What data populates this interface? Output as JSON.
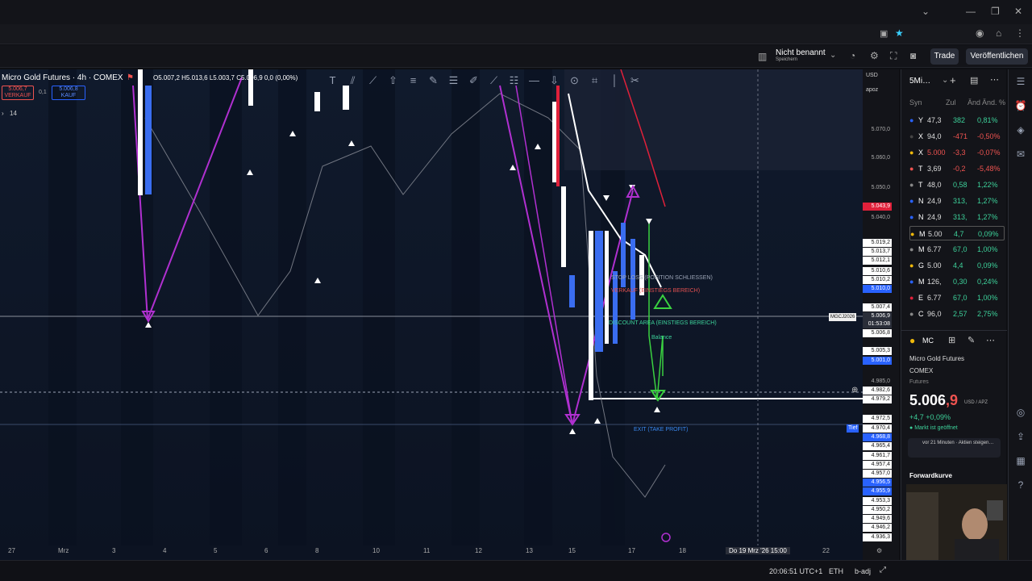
{
  "header": {
    "chart_name": "Nicht benannt",
    "chart_save": "Speichern",
    "trade_label": "Trade",
    "publish_label": "Veröffentlichen"
  },
  "legend": {
    "symbol": "Micro Gold Futures · 4h · COMEX",
    "ohlc": "O5.007,2 H5.013,6 L5.003,7 C5.006,9 0,0 (0,00%)",
    "sell_price": "5.006,7",
    "sell_label": "VERKAUF",
    "spread": "0,1",
    "buy_price": "5.006,8",
    "buy_label": "KAUF",
    "indicator_value": "14"
  },
  "price_axis": {
    "currency": "USD",
    "unit": "apoz",
    "labels": [
      "5.070,0",
      "5.060,0",
      "5.050,0",
      "5.043,9",
      "5.040,0",
      "5.019,2",
      "5.013,7",
      "5.012,1",
      "5.010,6",
      "5.010,2",
      "5.010,0",
      "5.007,4",
      "5.006,9",
      "01:53:08",
      "5.006,8",
      "5.005,3",
      "5.001,0",
      "4.985,0",
      "4.982,6",
      "4.979,2",
      "4.972,5",
      "4.970,4",
      "4.968,8",
      "4.965,4",
      "4.961,7",
      "4.957,4",
      "4.957,0",
      "4.956,5",
      "4.955,9",
      "4.953,3",
      "4.950,2",
      "4.949,6",
      "4.946,2",
      "4.936,3"
    ],
    "symbol_tag": "MGCJ2026",
    "tief_tag": "Tief"
  },
  "annotations": {
    "stop_loss": "STOP LOSS (POSITION SCHLIESSEN)",
    "verkauf_zone": "VERKAUF (EINSTIEGS BEREICH)",
    "discount_zone": "DISCOUNT AREA (EINSTIEGS BEREICH)",
    "balance": "Balance",
    "exit": "EXIT (TAKE PROFIT)"
  },
  "time_axis": {
    "labels": [
      "27",
      "Mrz",
      "3",
      "4",
      "5",
      "6",
      "8",
      "10",
      "11",
      "12",
      "13",
      "15",
      "17",
      "18",
      "22"
    ],
    "crosshair": "Do 19 Mrz '26  15:00"
  },
  "status": {
    "clock": "20:06:51 UTC+1",
    "eth": "ETH",
    "badj": "b-adj"
  },
  "watchlist": {
    "timeframe": "5Mi…",
    "columns": [
      "Syn",
      "Zul",
      "Änd",
      "Änd. %"
    ],
    "rows": [
      {
        "sym": "Y",
        "last": "47,3",
        "chg": "382",
        "pct": "0,81%",
        "dir": "pos"
      },
      {
        "sym": "X",
        "last": "94,0",
        "chg": "-471",
        "pct": "-0,50%",
        "dir": "neg"
      },
      {
        "sym": "X",
        "last": "5.000",
        "chg": "-3,3",
        "pct": "-0,07%",
        "dir": "neg"
      },
      {
        "sym": "T",
        "last": "3,69",
        "chg": "-0,2",
        "pct": "-5,48%",
        "dir": "neg"
      },
      {
        "sym": "T",
        "last": "48,0",
        "chg": "0,58",
        "pct": "1,22%",
        "dir": "pos"
      },
      {
        "sym": "N",
        "last": "24,9",
        "chg": "313,",
        "pct": "1,27%",
        "dir": "pos"
      },
      {
        "sym": "N",
        "last": "24,9",
        "chg": "313,",
        "pct": "1,27%",
        "dir": "pos"
      },
      {
        "sym": "M",
        "last": "5.00",
        "chg": "4,7",
        "pct": "0,09%",
        "dir": "pos"
      },
      {
        "sym": "M",
        "last": "6.77",
        "chg": "67,0",
        "pct": "1,00%",
        "dir": "pos"
      },
      {
        "sym": "G",
        "last": "5.00",
        "chg": "4,4",
        "pct": "0,09%",
        "dir": "pos"
      },
      {
        "sym": "M",
        "last": "126,",
        "chg": "0,30",
        "pct": "0,24%",
        "dir": "pos"
      },
      {
        "sym": "E",
        "last": "6.77",
        "chg": "67,0",
        "pct": "1,00%",
        "dir": "pos"
      },
      {
        "sym": "C",
        "last": "96,0",
        "chg": "2,57",
        "pct": "2,75%",
        "dir": "pos"
      }
    ]
  },
  "details": {
    "short": "MC",
    "name": "Micro Gold Futures",
    "exchange": "COMEX",
    "type": "Futures",
    "price_main": "5.006",
    "price_frac": ",9",
    "unit": "USD / APZ",
    "change": "+4,7 +0,09%",
    "market_status": "Markt ist geöffnet",
    "news": "vor 21 Minuten · Aktien steigen…",
    "forward": "Forwardkurve"
  }
}
